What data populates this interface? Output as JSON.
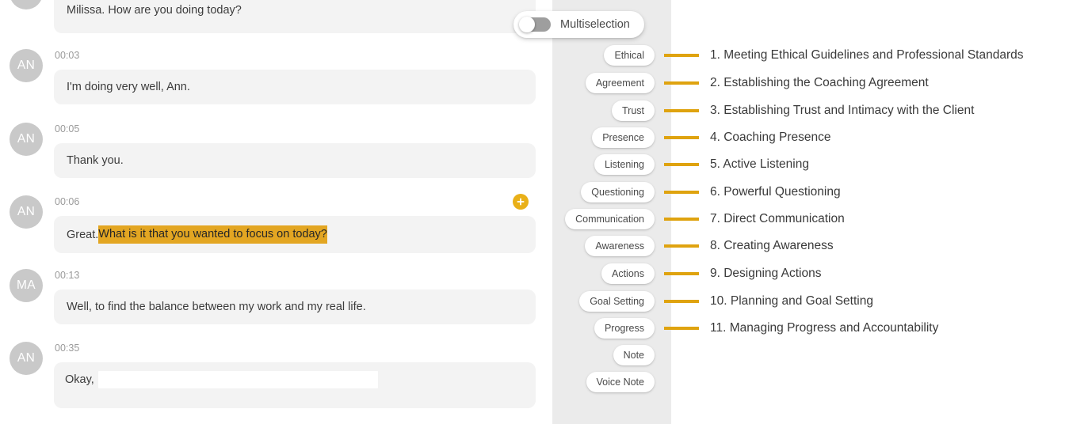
{
  "transcript": {
    "partial_top_message": {
      "text": "Milissa. How are you doing today?"
    },
    "messages": [
      {
        "avatar": "AN",
        "timestamp": "00:03",
        "text": "I'm doing very well, Ann.",
        "kind": "plain"
      },
      {
        "avatar": "AN",
        "timestamp": "00:05",
        "text": "Thank you.",
        "kind": "plain"
      },
      {
        "avatar": "AN",
        "timestamp": "00:06",
        "kind": "highlighted",
        "text_prefix": "Great. ",
        "text_highlight": "What is it that you wanted to focus on today?",
        "badge_icon": "plus-icon"
      },
      {
        "avatar": "MA",
        "timestamp": "00:13",
        "text": "Well, to find the balance between my work and my real life.",
        "kind": "plain"
      },
      {
        "avatar": "AN",
        "timestamp": "00:35",
        "kind": "skeleton",
        "text": "Okay,"
      }
    ]
  },
  "multiselection": {
    "label": "Multiselection",
    "enabled": false
  },
  "sidebar": {
    "pills": [
      {
        "label": "Ethical"
      },
      {
        "label": "Agreement"
      },
      {
        "label": "Trust"
      },
      {
        "label": "Presence"
      },
      {
        "label": "Listening"
      },
      {
        "label": "Questioning"
      },
      {
        "label": "Communication"
      },
      {
        "label": "Awareness"
      },
      {
        "label": "Actions"
      },
      {
        "label": "Goal Setting"
      },
      {
        "label": "Progress"
      },
      {
        "label": "Note"
      },
      {
        "label": "Voice Note"
      }
    ]
  },
  "competencies": [
    {
      "text": "1. Meeting Ethical Guidelines and Professional Standards"
    },
    {
      "text": "2. Establishing the Coaching Agreement"
    },
    {
      "text": "3. Establishing Trust and Intimacy with the Client"
    },
    {
      "text": "4. Coaching Presence"
    },
    {
      "text": "5. Active Listening"
    },
    {
      "text": "6. Powerful Questioning"
    },
    {
      "text": "7. Direct Communication"
    },
    {
      "text": "8. Creating Awareness"
    },
    {
      "text": "9. Designing Actions"
    },
    {
      "text": "10. Planning and Goal Setting"
    },
    {
      "text": "11. Managing Progress and Accountability"
    }
  ],
  "colors": {
    "accent_orange": "#dfa30f",
    "highlight": "#e3a622",
    "badge": "#e9b018",
    "sidebar_bg": "#ebebeb",
    "bubble_bg": "#f3f3f3",
    "avatar_bg": "#c9c9c9"
  }
}
